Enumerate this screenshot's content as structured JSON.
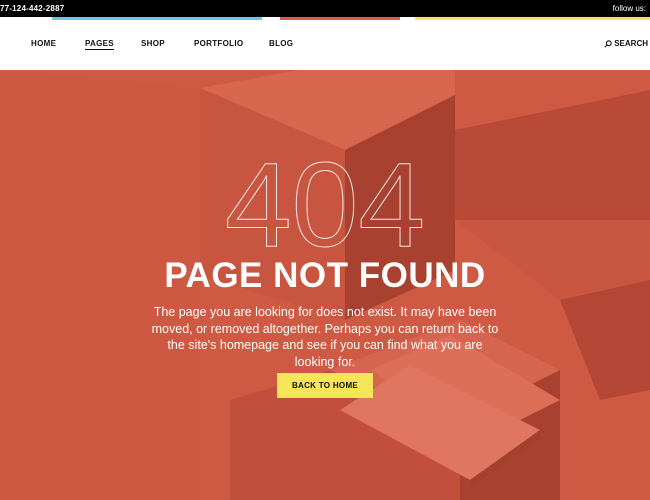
{
  "topbar": {
    "phone": "77-124-442-2887",
    "follow": "follow us:"
  },
  "nav": {
    "items": [
      {
        "label": "HOME"
      },
      {
        "label": "PAGES",
        "active": true
      },
      {
        "label": "SHOP"
      },
      {
        "label": "PORTFOLIO"
      },
      {
        "label": "BLOG"
      }
    ],
    "search_label": "SEARCH"
  },
  "hero": {
    "code": "404",
    "title": "PAGE NOT FOUND",
    "description": "The page you are looking for does not exist. It may have been moved, or removed altogether. Perhaps you can return back to the site's homepage and see if you can find what you are looking for.",
    "button_label": "BACK TO HOME"
  },
  "colors": {
    "hero_bg": "#cf5a44",
    "button_bg": "#f6e45a",
    "stripe_blue": "#6ec6f0",
    "stripe_red": "#e8534a",
    "stripe_yellow": "#f6e45a"
  }
}
